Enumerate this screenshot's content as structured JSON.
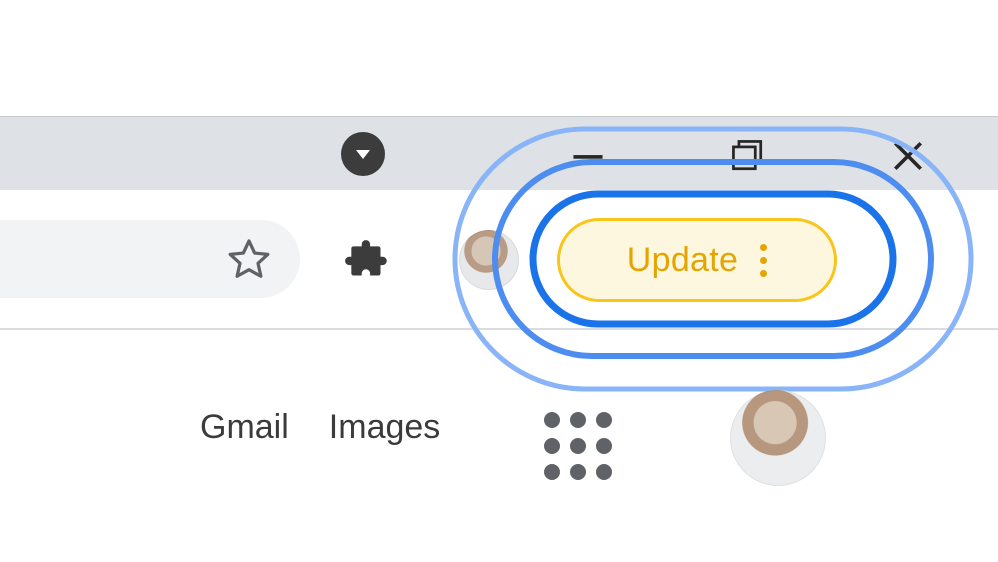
{
  "colors": {
    "tab_strip_bg": "#dee1e6",
    "toolbar_bg": "#ffffff",
    "omnibox_bg": "#f1f3f4",
    "divider": "#d9dce0",
    "icon_dark": "#3c3c3c",
    "icon_grey": "#5f6368",
    "update_pill_bg": "#fef7e0",
    "update_pill_border": "#f9c518",
    "update_text": "#e6a400",
    "ring_inner": "#1a73e8",
    "ring_mid": "#4d8df0",
    "ring_outer": "#8ab4f8"
  },
  "window_controls": {
    "minimize_icon": "minimize-icon",
    "maximize_icon": "maximize-icon",
    "close_icon": "close-icon"
  },
  "tab_strip": {
    "dropdown_icon": "caret-down-icon"
  },
  "toolbar": {
    "bookmark_icon": "star-outline-icon",
    "extensions_icon": "puzzle-piece-icon",
    "profile_icon": "profile-avatar",
    "update": {
      "label": "Update",
      "menu_icon": "vertical-dots-icon"
    }
  },
  "content": {
    "gmail_label": "Gmail",
    "images_label": "Images",
    "apps_icon": "apps-grid-icon",
    "account_avatar": "profile-avatar"
  },
  "highlight": {
    "ring_count": 3
  }
}
